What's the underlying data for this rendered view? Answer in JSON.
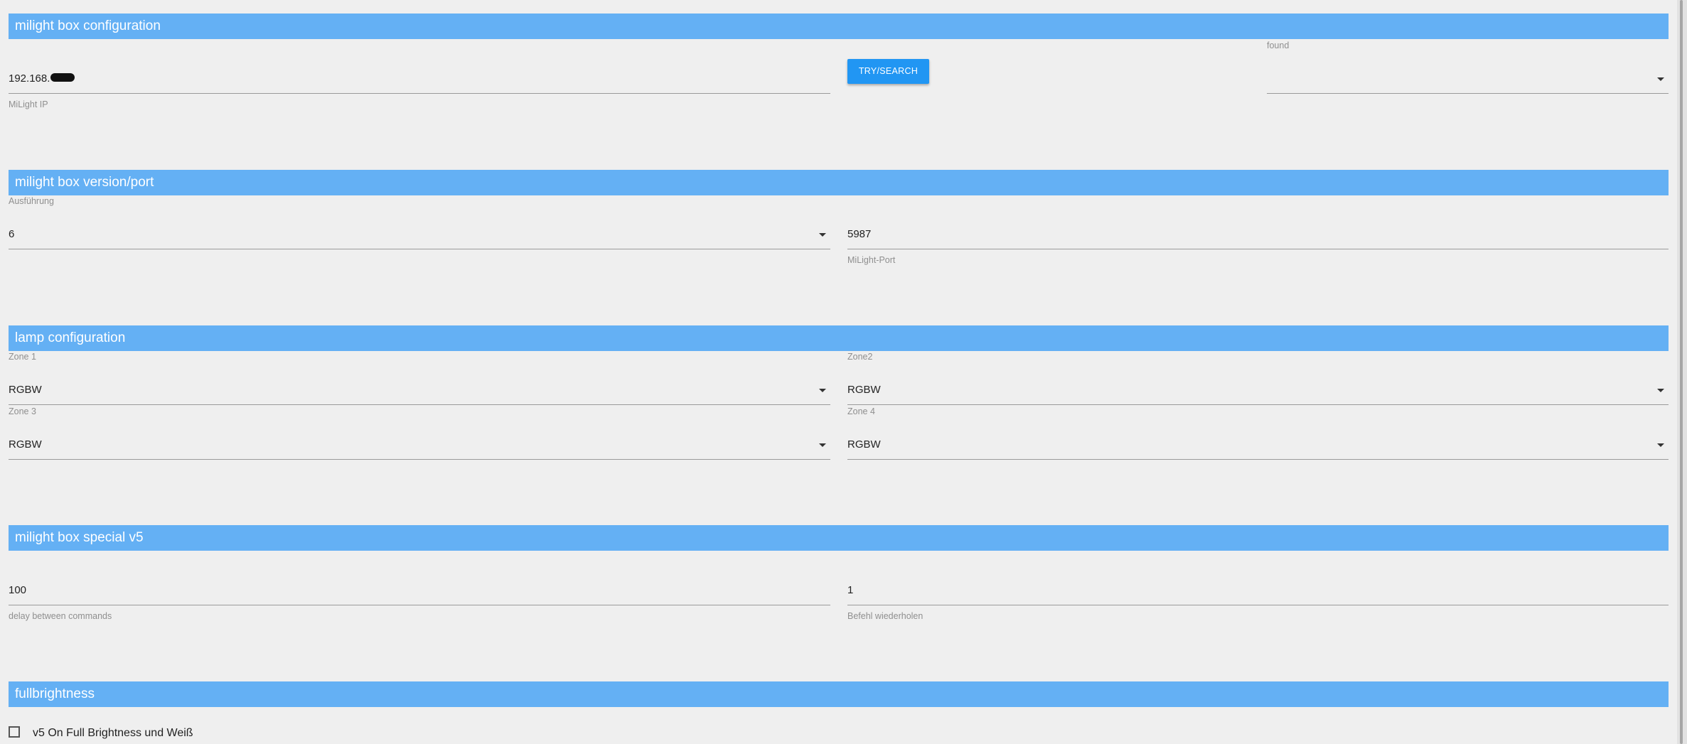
{
  "sections": {
    "box_config": "milight box configuration",
    "version_port": "milight box version/port",
    "lamp_config": "lamp configuration",
    "special_v5": "milight box special v5",
    "fullbrightness": "fullbrightness"
  },
  "box_config": {
    "ip_value": "192.168.",
    "ip_label": "MiLight IP",
    "search_button": "TRY/SEARCH",
    "found_label": "found",
    "found_value": ""
  },
  "version_port": {
    "version_label": "Ausführung",
    "version_value": "6",
    "port_value": "5987",
    "port_label": "MiLight-Port"
  },
  "lamp_config": {
    "zones": [
      {
        "label": "Zone 1",
        "value": "RGBW"
      },
      {
        "label": "Zone2",
        "value": "RGBW"
      },
      {
        "label": "Zone 3",
        "value": "RGBW"
      },
      {
        "label": "Zone 4",
        "value": "RGBW"
      }
    ]
  },
  "special_v5": {
    "delay_value": "100",
    "delay_label": "delay between commands",
    "repeat_value": "1",
    "repeat_label": "Befehl wiederholen"
  },
  "fullbrightness": {
    "checkbox_label": "v5 On Full Brightness und Weiß",
    "checked": false
  },
  "colors": {
    "header_bg": "#64b0f4",
    "button_bg": "#2196f3",
    "page_bg": "#efefef"
  }
}
